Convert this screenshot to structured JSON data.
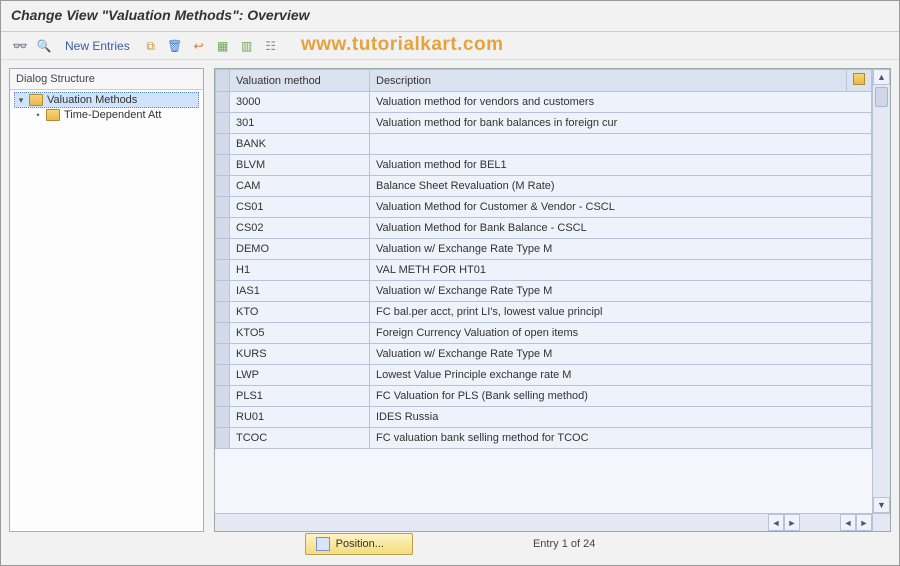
{
  "title": "Change View \"Valuation Methods\": Overview",
  "watermark": "www.tutorialkart.com",
  "toolbar": {
    "new_entries": "New Entries"
  },
  "tree": {
    "header": "Dialog Structure",
    "root": {
      "label": "Valuation Methods"
    },
    "child": {
      "label": "Time-Dependent Att"
    }
  },
  "table": {
    "headers": {
      "method": "Valuation method",
      "desc": "Description"
    },
    "rows": [
      {
        "method": "3000",
        "desc": "Valuation method for vendors and customers"
      },
      {
        "method": "301",
        "desc": "Valuation method for bank balances in foreign cur"
      },
      {
        "method": "BANK",
        "desc": ""
      },
      {
        "method": "BLVM",
        "desc": "Valuation method for BEL1"
      },
      {
        "method": "CAM",
        "desc": "Balance Sheet Revaluation (M Rate)"
      },
      {
        "method": "CS01",
        "desc": "Valuation Method for Customer & Vendor - CSCL"
      },
      {
        "method": "CS02",
        "desc": "Valuation Method for Bank Balance - CSCL"
      },
      {
        "method": "DEMO",
        "desc": "Valuation w/ Exchange Rate Type M"
      },
      {
        "method": "H1",
        "desc": "VAL METH FOR HT01"
      },
      {
        "method": "IAS1",
        "desc": "Valuation w/ Exchange Rate Type M"
      },
      {
        "method": "KTO",
        "desc": "FC bal.per acct, print LI's, lowest value principl"
      },
      {
        "method": "KTO5",
        "desc": "Foreign Currency Valuation of open items"
      },
      {
        "method": "KURS",
        "desc": "Valuation w/ Exchange Rate Type M"
      },
      {
        "method": "LWP",
        "desc": "Lowest Value Principle exchange rate M"
      },
      {
        "method": "PLS1",
        "desc": "FC Valuation for PLS (Bank selling method)"
      },
      {
        "method": "RU01",
        "desc": "IDES Russia"
      },
      {
        "method": "TCOC",
        "desc": "FC valuation bank selling method for TCOC"
      }
    ]
  },
  "footer": {
    "position_label": "Position...",
    "entry_text": "Entry 1 of 24"
  }
}
